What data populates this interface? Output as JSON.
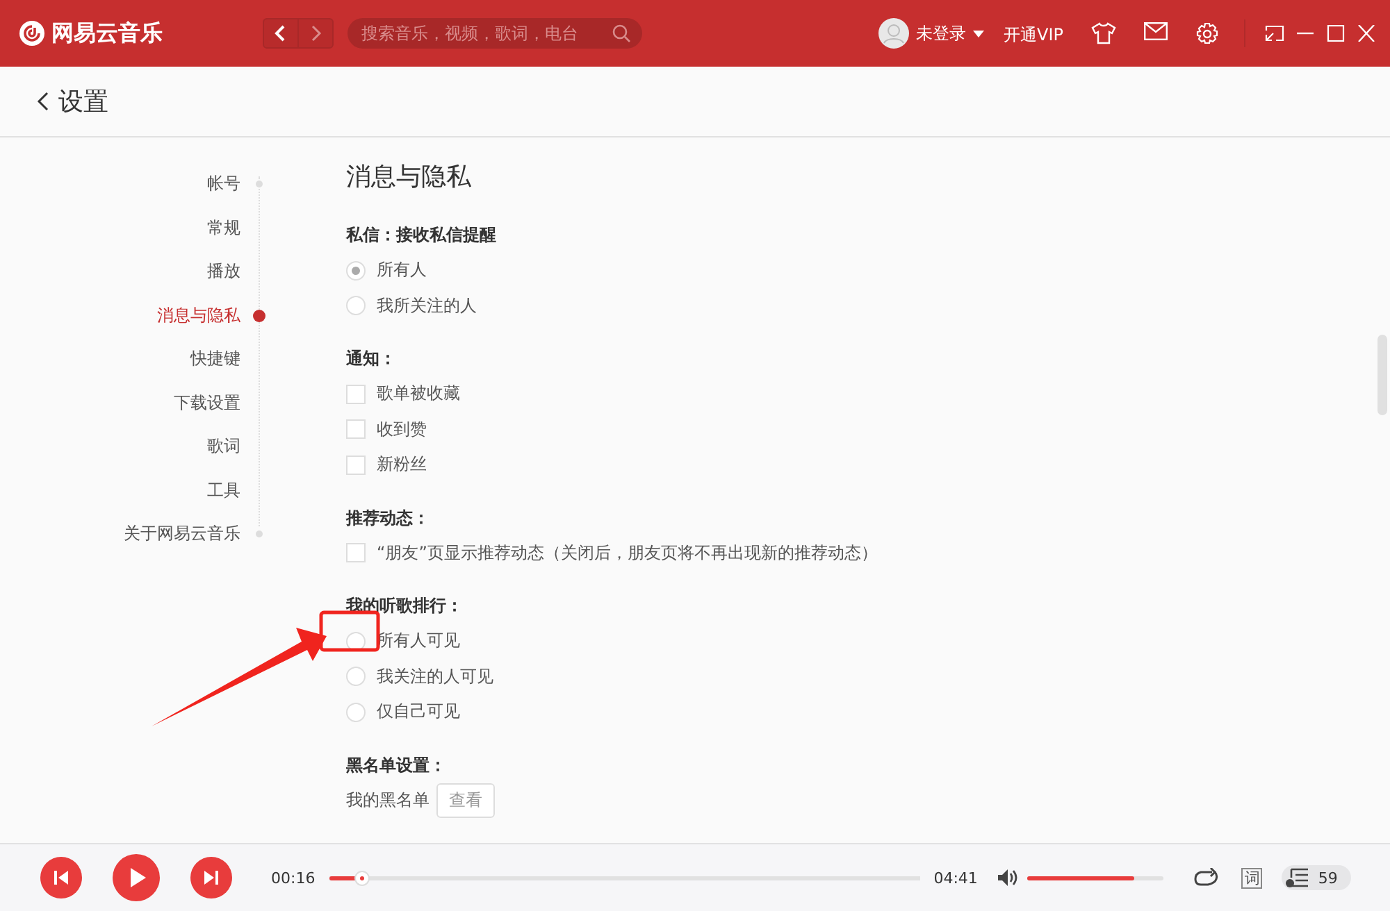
{
  "app": {
    "name": "网易云音乐"
  },
  "search": {
    "placeholder": "搜索音乐，视频，歌词，电台"
  },
  "user": {
    "name": "未登录",
    "vip": "开通VIP"
  },
  "page": {
    "title": "设置"
  },
  "sidebar": {
    "items": [
      {
        "label": "帐号",
        "selected": false
      },
      {
        "label": "常规",
        "selected": false
      },
      {
        "label": "播放",
        "selected": false
      },
      {
        "label": "消息与隐私",
        "selected": true
      },
      {
        "label": "快捷键",
        "selected": false
      },
      {
        "label": "下载设置",
        "selected": false
      },
      {
        "label": "歌词",
        "selected": false
      },
      {
        "label": "工具",
        "selected": false
      },
      {
        "label": "关于网易云音乐",
        "selected": false
      }
    ]
  },
  "section": {
    "title": "消息与隐私",
    "groups": [
      {
        "label": "私信：接收私信提醒",
        "kind": "radio",
        "options": [
          {
            "label": "所有人",
            "selected": true
          },
          {
            "label": "我所关注的人",
            "selected": false
          }
        ]
      },
      {
        "label": "通知：",
        "kind": "checkbox",
        "options": [
          {
            "label": "歌单被收藏",
            "checked": false
          },
          {
            "label": "收到赞",
            "checked": false
          },
          {
            "label": "新粉丝",
            "checked": false
          }
        ]
      },
      {
        "label": "推荐动态：",
        "kind": "checkbox",
        "options": [
          {
            "label": "“朋友”页显示推荐动态（关闭后，朋友页将不再出现新的推荐动态）",
            "checked": false
          }
        ]
      },
      {
        "label": "我的听歌排行：",
        "kind": "radio",
        "options": [
          {
            "label": "所有人可见",
            "selected": false
          },
          {
            "label": "我关注的人可见",
            "selected": false
          },
          {
            "label": "仅自己可见",
            "selected": false
          }
        ]
      },
      {
        "label": "黑名单设置：",
        "kind": "action",
        "text": "我的黑名单",
        "button": "查看"
      }
    ]
  },
  "player": {
    "elapsed": "00:16",
    "duration": "04:41",
    "progress": {
      "level": 0.056
    },
    "volume": {
      "level": 0.78
    },
    "lyrics": "词",
    "playlist_count": "59"
  }
}
